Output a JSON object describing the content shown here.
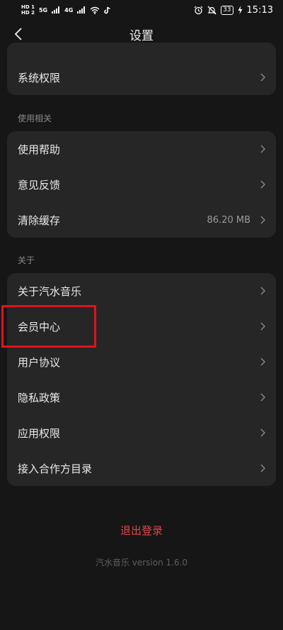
{
  "status_bar": {
    "hd1": "HD 1",
    "hd2": "HD 2",
    "sig1": "5G",
    "sig2": "4G",
    "battery": "33",
    "time": "15:13"
  },
  "header": {
    "title": "设置"
  },
  "top_card": {
    "items": [
      {
        "label": "系统权限"
      }
    ]
  },
  "usage_section": {
    "label": "使用相关",
    "items": [
      {
        "label": "使用帮助"
      },
      {
        "label": "意见反馈"
      },
      {
        "label": "清除缓存",
        "value": "86.20 MB"
      }
    ]
  },
  "about_section": {
    "label": "关于",
    "items": [
      {
        "label": "关于汽水音乐"
      },
      {
        "label": "会员中心"
      },
      {
        "label": "用户协议"
      },
      {
        "label": "隐私政策"
      },
      {
        "label": "应用权限"
      },
      {
        "label": "接入合作方目录"
      }
    ]
  },
  "footer": {
    "logout": "退出登录",
    "version": "汽水音乐 version 1.6.0"
  },
  "colors": {
    "background": "#161616",
    "card": "#262626",
    "logout": "#e0454b",
    "highlight": "#e3121c"
  },
  "icons": {
    "back": "chevron-left-icon",
    "row": "chevron-right-icon"
  }
}
